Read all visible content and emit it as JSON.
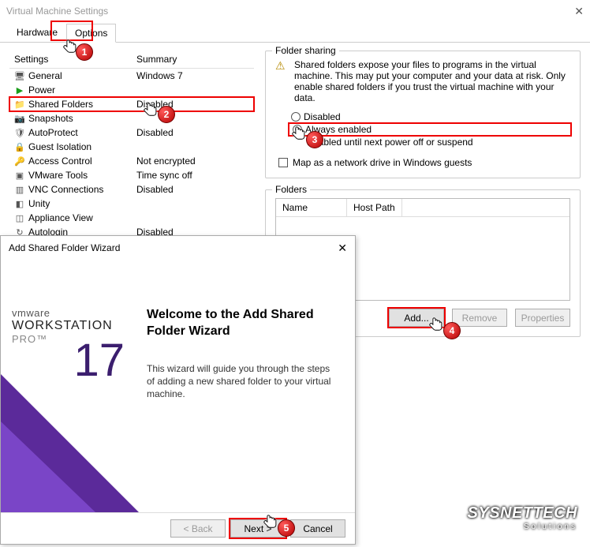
{
  "window": {
    "title": "Virtual Machine Settings"
  },
  "tabs": {
    "hardware": "Hardware",
    "options": "Options"
  },
  "settings_header": {
    "col1": "Settings",
    "col2": "Summary"
  },
  "settings_rows": [
    {
      "icon": "monitor",
      "name": "General",
      "summary": "Windows 7"
    },
    {
      "icon": "play",
      "name": "Power",
      "summary": ""
    },
    {
      "icon": "folder",
      "name": "Shared Folders",
      "summary": "Disabled",
      "highlight": true
    },
    {
      "icon": "camera",
      "name": "Snapshots",
      "summary": ""
    },
    {
      "icon": "shield",
      "name": "AutoProtect",
      "summary": "Disabled"
    },
    {
      "icon": "lock",
      "name": "Guest Isolation",
      "summary": ""
    },
    {
      "icon": "key",
      "name": "Access Control",
      "summary": "Not encrypted"
    },
    {
      "icon": "vm",
      "name": "VMware Tools",
      "summary": "Time sync off"
    },
    {
      "icon": "vnc",
      "name": "VNC Connections",
      "summary": "Disabled"
    },
    {
      "icon": "unity",
      "name": "Unity",
      "summary": ""
    },
    {
      "icon": "app",
      "name": "Appliance View",
      "summary": ""
    },
    {
      "icon": "auto",
      "name": "Autologin",
      "summary": "Disabled"
    }
  ],
  "sharing": {
    "legend": "Folder sharing",
    "warning": "Shared folders expose your files to programs in the virtual machine. This may put your computer and your data at risk. Only enable shared folders if you trust the virtual machine with your data.",
    "opt_disabled": "Disabled",
    "opt_always": "Always enabled",
    "opt_until": "Enabled until next power off or suspend",
    "map_drive": "Map as a network drive in Windows guests"
  },
  "folders": {
    "legend": "Folders",
    "col_name": "Name",
    "col_path": "Host Path",
    "btn_add": "Add...",
    "btn_remove": "Remove",
    "btn_props": "Properties"
  },
  "wizard": {
    "title": "Add Shared Folder Wizard",
    "brand1": "vmware",
    "brand2": "WORKSTATION",
    "brand3": "PRO™",
    "version": "17",
    "heading": "Welcome to the Add Shared Folder Wizard",
    "body": "This wizard will guide you through the steps of adding a new shared folder to your virtual machine.",
    "btn_back": "< Back",
    "btn_next": "Next >",
    "btn_cancel": "Cancel"
  },
  "steps": {
    "s1": "1",
    "s2": "2",
    "s3": "3",
    "s4": "4",
    "s5": "5"
  },
  "watermark": {
    "brand": "SYSNETTECH",
    "sub": "Solutions"
  }
}
